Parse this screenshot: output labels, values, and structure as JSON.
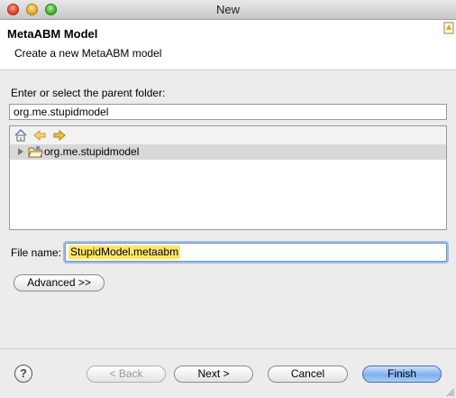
{
  "window": {
    "title": "New"
  },
  "header": {
    "title": "MetaABM Model",
    "description": "Create a new MetaABM model"
  },
  "folder": {
    "label": "Enter or select the parent folder:",
    "value": "org.me.stupidmodel"
  },
  "tree": {
    "toolbar_icons": [
      "home-icon",
      "back-arrow-icon",
      "forward-arrow-icon"
    ],
    "items": [
      {
        "label": "org.me.stupidmodel",
        "icon": "folder-icon",
        "expanded": false,
        "selected": true
      }
    ]
  },
  "file": {
    "label": "File name:",
    "value": "StupidModel.metaabm"
  },
  "buttons": {
    "advanced": "Advanced >>",
    "back": "< Back",
    "next": "Next >",
    "cancel": "Cancel",
    "finish": "Finish",
    "help": "?"
  },
  "colors": {
    "selection_highlight": "#fde56a",
    "default_button": "#7fb0ef",
    "focus_ring": "#9ebee6"
  }
}
